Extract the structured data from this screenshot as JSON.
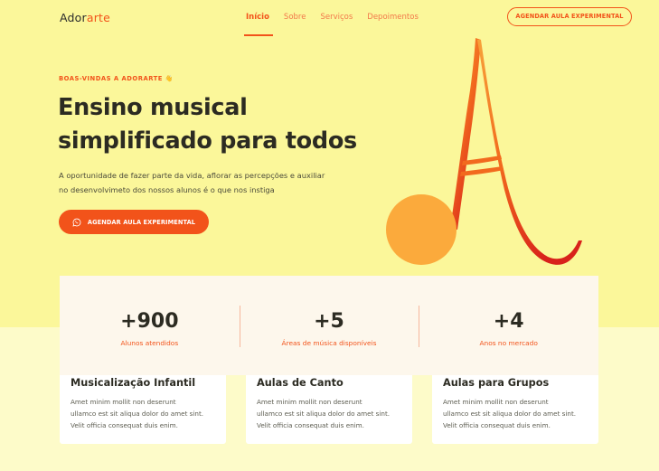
{
  "brand": {
    "part1": "Ador",
    "part2": "arte"
  },
  "nav": {
    "items": [
      {
        "label": "Início",
        "active": true
      },
      {
        "label": "Sobre",
        "active": false
      },
      {
        "label": "Serviços",
        "active": false
      },
      {
        "label": "Depoimentos",
        "active": false
      }
    ],
    "cta_label": "AGENDAR AULA EXPERIMENTAL"
  },
  "hero": {
    "eyebrow": "BOAS-VINDAS A ADORARTE",
    "eyebrow_icon": "👋",
    "headline_line1": "Ensino musical",
    "headline_line2": "simplificado para todos",
    "subtext_line1": "A oportunidade de fazer parte da vida, aflorar as percepções e auxiliar",
    "subtext_line2": "no desenvolvimeto dos nossos alunos é o que nos instiga",
    "cta_label": "AGENDAR AULA EXPERIMENTAL",
    "cta_icon": "whatsapp-icon"
  },
  "stats": [
    {
      "value": "+900",
      "label": "Alunos atendidos"
    },
    {
      "value": "+5",
      "label": "Áreas de música disponíveis"
    },
    {
      "value": "+4",
      "label": "Anos no mercado"
    }
  ],
  "services": [
    {
      "title": "Musicalização Infantil",
      "line1": "Amet minim mollit non deserunt",
      "line2": "ullamco est sit aliqua dolor do amet sint.",
      "line3": "Velit officia consequat duis enim."
    },
    {
      "title": "Aulas de Canto",
      "line1": "Amet minim mollit non deserunt",
      "line2": "ullamco est sit aliqua dolor do amet sint.",
      "line3": "Velit officia consequat duis enim."
    },
    {
      "title": "Aulas para Grupos",
      "line1": "Amet minim mollit non deserunt",
      "line2": "ullamco est sit aliqua dolor do amet sint.",
      "line3": "Velit officia consequat duis enim."
    }
  ],
  "colors": {
    "accent": "#f2531a",
    "hero_bg": "#fbf79a",
    "note_orange": "#fbaa3c"
  }
}
